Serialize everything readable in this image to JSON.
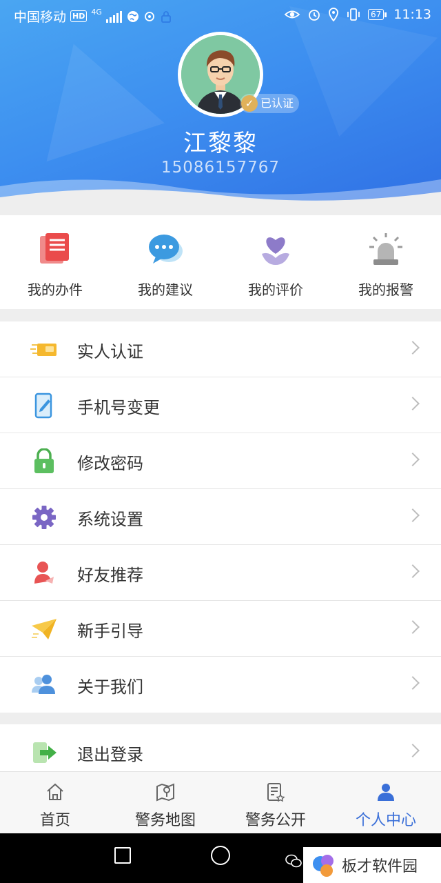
{
  "status_bar": {
    "carrier": "中国移动",
    "hd": "HD",
    "network": "4G",
    "battery": "67",
    "time": "11:13"
  },
  "profile": {
    "verified_label": "已认证",
    "name": "江黎黎",
    "phone": "15086157767"
  },
  "quick_actions": [
    {
      "label": "我的办件",
      "icon": "document-icon"
    },
    {
      "label": "我的建议",
      "icon": "chat-bubble-icon"
    },
    {
      "label": "我的评价",
      "icon": "heart-flower-icon"
    },
    {
      "label": "我的报警",
      "icon": "alarm-light-icon"
    }
  ],
  "menu": [
    {
      "label": "实人认证",
      "icon": "id-card-icon"
    },
    {
      "label": "手机号变更",
      "icon": "phone-edit-icon"
    },
    {
      "label": "修改密码",
      "icon": "lock-icon"
    },
    {
      "label": "系统设置",
      "icon": "gear-icon"
    },
    {
      "label": "好友推荐",
      "icon": "user-recommend-icon"
    },
    {
      "label": "新手引导",
      "icon": "paper-plane-icon"
    },
    {
      "label": "关于我们",
      "icon": "group-icon"
    }
  ],
  "logout": {
    "label": "退出登录",
    "icon": "exit-icon"
  },
  "tabs": [
    {
      "label": "首页",
      "icon": "home-icon",
      "active": false
    },
    {
      "label": "警务地图",
      "icon": "map-icon",
      "active": false
    },
    {
      "label": "警务公开",
      "icon": "notice-icon",
      "active": false
    },
    {
      "label": "个人中心",
      "icon": "person-icon",
      "active": true
    }
  ],
  "watermark": "板才软件园",
  "colors": {
    "header_blue": "#3d8ff0",
    "active_tab": "#3a6fd8",
    "verified_gold": "#e0b15a"
  }
}
